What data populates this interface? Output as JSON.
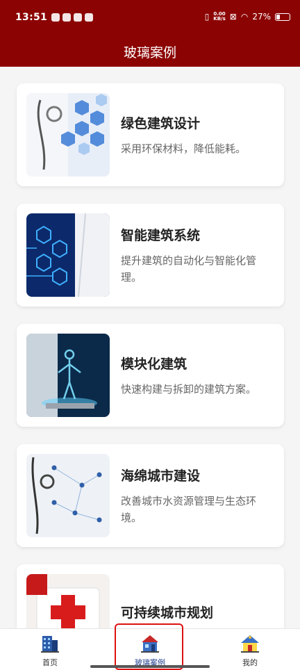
{
  "status": {
    "time": "13:51",
    "speed_value": "0.00",
    "speed_unit": "KB/s",
    "battery": "27%",
    "battery_level": 0.27
  },
  "header": {
    "title": "玻璃案例"
  },
  "cases": [
    {
      "title": "绿色建筑设计",
      "desc": "采用环保材料，降低能耗。",
      "icon": "medical-hexagon-image"
    },
    {
      "title": "智能建筑系统",
      "desc": "提升建筑的自动化与智能化管理。",
      "icon": "tech-hexagon-image"
    },
    {
      "title": "模块化建筑",
      "desc": "快速构建与拆卸的建筑方案。",
      "icon": "hologram-body-image"
    },
    {
      "title": "海绵城市建设",
      "desc": "改善城市水资源管理与生态环境。",
      "icon": "stethoscope-network-image"
    },
    {
      "title": "可持续城市规划",
      "desc": "",
      "icon": "first-aid-kit-image"
    }
  ],
  "tabs": [
    {
      "label": "首页",
      "icon": "building-icon"
    },
    {
      "label": "玻璃案例",
      "icon": "house-icon",
      "active": true
    },
    {
      "label": "我的",
      "icon": "profile-house-icon"
    }
  ],
  "colors": {
    "primary": "#8c0303",
    "tab_active": "#1f3c8c"
  }
}
